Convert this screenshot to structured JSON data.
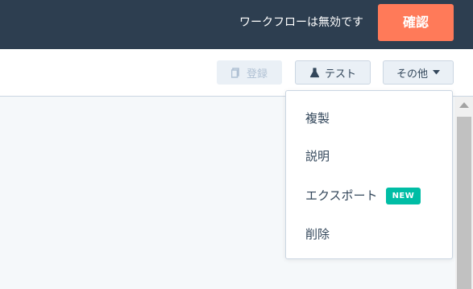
{
  "header": {
    "status_text": "ワークフローは無効です",
    "confirm_label": "確認"
  },
  "toolbar": {
    "register_label": "登録",
    "test_label": "テスト",
    "more_label": "その他"
  },
  "dropdown": {
    "items": [
      {
        "label": "複製"
      },
      {
        "label": "説明"
      },
      {
        "label": "エクスポート",
        "badge": "NEW"
      },
      {
        "label": "削除"
      }
    ]
  },
  "colors": {
    "header_bg": "#2d3e50",
    "accent": "#ff7a59",
    "badge": "#00bda5",
    "text": "#33475b"
  },
  "icons": [
    "register-icon",
    "flask-icon",
    "caret-down-icon",
    "scroll-up-arrow-icon"
  ]
}
